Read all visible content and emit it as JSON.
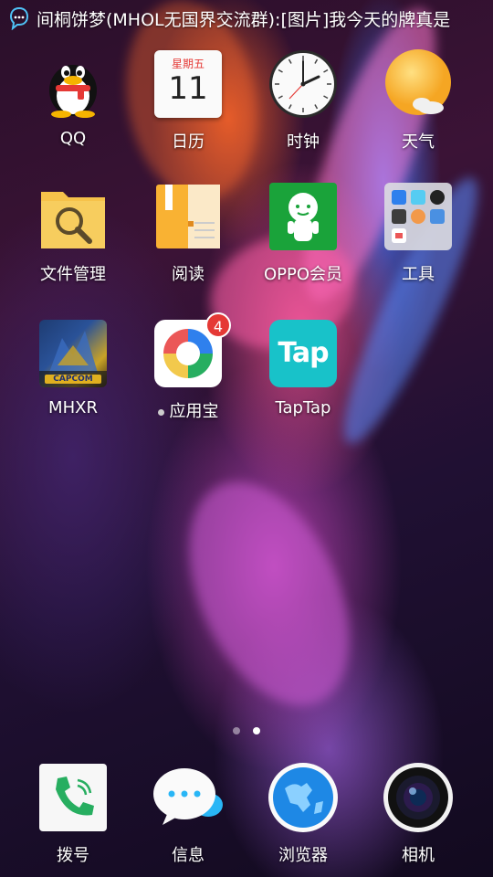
{
  "statusbar": {
    "notification_text": "间桐饼梦(MHOL无国界交流群):[图片]我今天的牌真是"
  },
  "apps": [
    {
      "label": "QQ",
      "icon": "qq-penguin-icon"
    },
    {
      "label": "日历",
      "icon": "calendar-icon",
      "weekday": "星期五",
      "day": "11"
    },
    {
      "label": "时钟",
      "icon": "clock-icon"
    },
    {
      "label": "天气",
      "icon": "weather-sun-icon"
    },
    {
      "label": "文件管理",
      "icon": "folder-search-icon"
    },
    {
      "label": "阅读",
      "icon": "book-icon"
    },
    {
      "label": "OPPO会员",
      "icon": "oppo-member-icon"
    },
    {
      "label": "工具",
      "icon": "tools-folder-icon"
    },
    {
      "label": "MHXR",
      "icon": "mhxr-game-icon",
      "badge_text": "CAPCOM"
    },
    {
      "label": "应用宝",
      "icon": "app-store-icon",
      "badge": "4"
    },
    {
      "label": "TapTap",
      "icon": "taptap-icon",
      "icon_text": "Tap"
    }
  ],
  "page_indicator": {
    "pages": 2,
    "current": 2
  },
  "dock": [
    {
      "label": "拨号",
      "icon": "phone-icon"
    },
    {
      "label": "信息",
      "icon": "message-icon"
    },
    {
      "label": "浏览器",
      "icon": "browser-globe-icon"
    },
    {
      "label": "相机",
      "icon": "camera-icon"
    }
  ],
  "colors": {
    "badge": "#e53935",
    "oppo_green": "#1aa33a",
    "taptap_teal": "#18c2c9",
    "folder_yellow": "#f6c24a"
  }
}
